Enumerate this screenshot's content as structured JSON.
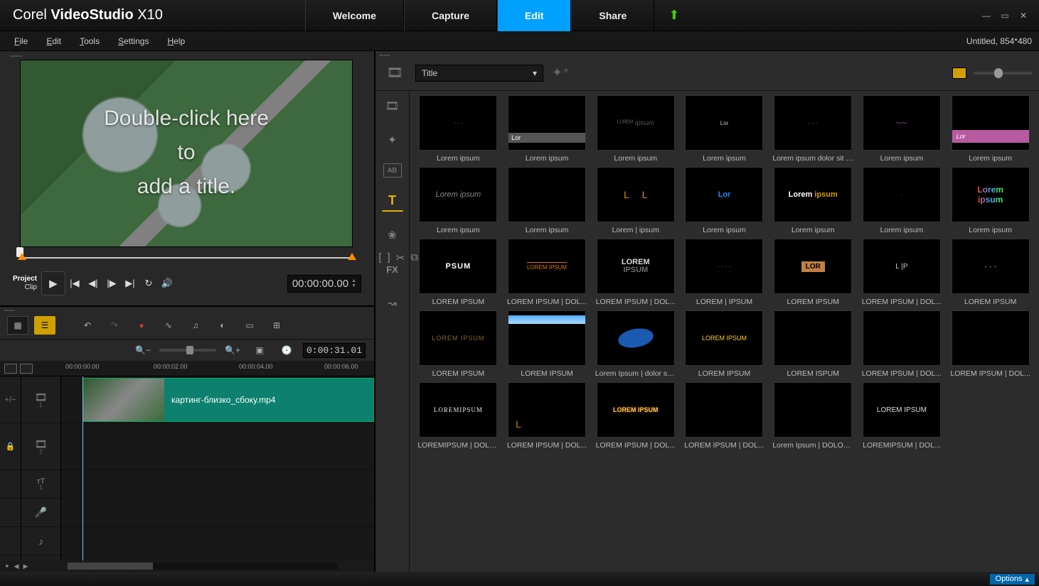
{
  "app": {
    "brand": "Corel",
    "name1": "VideoStudio",
    "name2": "X10"
  },
  "doc_info": "Untitled, 854*480",
  "main_tabs": {
    "welcome": "Welcome",
    "capture": "Capture",
    "edit": "Edit",
    "share": "Share"
  },
  "menu": {
    "file": "File",
    "edit": "Edit",
    "tools": "Tools",
    "settings": "Settings",
    "help": "Help"
  },
  "preview": {
    "title_line1": "Double-click here",
    "title_line2": "to",
    "title_line3": "add a title.",
    "mode_project": "Project",
    "mode_clip": "Clip",
    "timecode": "00:00:00.00"
  },
  "timeline": {
    "duration": "0:00:31.01",
    "ticks": [
      "00:00:00.00",
      "00:00:02.00",
      "00:00:04.00",
      "00:00:06.00"
    ],
    "toggle_label": "+/−",
    "clip_name": "картинг-близко_сбоку.mp4",
    "track_numbers": [
      "1",
      "2",
      "1"
    ]
  },
  "library": {
    "category_selected": "Title",
    "cats": [
      "media",
      "transition",
      "ab",
      "title",
      "graphic",
      "fx",
      "path"
    ],
    "items": [
      {
        "label": "Lorem ipsum",
        "style": "dots"
      },
      {
        "label": "Lorem ipsum",
        "style": "lor-banner",
        "text": "Lor"
      },
      {
        "label": "Lorem ipsum",
        "style": "faint",
        "text": "ᴸᴼᴿᴱᴹ ipsum"
      },
      {
        "label": "Lorem ipsum",
        "style": "small",
        "text": "Lor"
      },
      {
        "label": "Lorem ipsum dolor sit a...",
        "style": "tiny",
        "text": "· · ·"
      },
      {
        "label": "Lorem ipsum",
        "style": "squiggle"
      },
      {
        "label": "Lorem ipsum",
        "style": "pink",
        "text": "Lor"
      },
      {
        "label": "Lorem ipsum",
        "style": "italic",
        "text": "Lorem ipsum"
      },
      {
        "label": "Lorem ipsum",
        "style": "blank"
      },
      {
        "label": "Lorem | ipsum",
        "style": "orange-l",
        "text": "L"
      },
      {
        "label": "Lorem ipsum",
        "style": "blue",
        "text": "Lor"
      },
      {
        "label": "Lorem ipsum",
        "style": "twotone",
        "text": "Lorem ipsum"
      },
      {
        "label": "Lorem ipsum",
        "style": "tiny2",
        "text": "·"
      },
      {
        "label": "Lorem ipsum",
        "style": "grad",
        "text": "Lorem ipsum"
      },
      {
        "label": "LOREM IPSUM",
        "style": "psum",
        "text": "PSUM"
      },
      {
        "label": "LOREM IPSUM | DOL...",
        "style": "orange-line",
        "text": "LOREM IPSUM"
      },
      {
        "label": "LOREM IPSUM | DOL...",
        "style": "stack",
        "text": "LOREM\nIPSUM"
      },
      {
        "label": "LOREM | IPSUM",
        "style": "split",
        "text": "· ·   · ·"
      },
      {
        "label": "LOREM IPSUM",
        "style": "orange-box",
        "text": "LOR"
      },
      {
        "label": "LOREM IPSUM | DOL...",
        "style": "side",
        "text": "L   |P"
      },
      {
        "label": "LOREM IPSUM",
        "style": "diag-dots"
      },
      {
        "label": "LOREM IPSUM",
        "style": "red-caps",
        "text": "LOREM IPSUM"
      },
      {
        "label": "LOREM IPSUM",
        "style": "sky"
      },
      {
        "label": "Lorem Ipsum |  dolor sit ...",
        "style": "oval"
      },
      {
        "label": "LOREM IPSUM",
        "style": "yellow",
        "text": "LOREM IPSUM"
      },
      {
        "label": "LOREM ISPUM",
        "style": "blank"
      },
      {
        "label": "LOREM IPSUM | DOL...",
        "style": "blank"
      },
      {
        "label": "LOREM IPSUM | DOL...",
        "style": "blank"
      },
      {
        "label": "LOREMIPSUM | DOLO...",
        "style": "serif",
        "text": "LOREMIPSUM"
      },
      {
        "label": "LOREM IPSUM | DOL...",
        "style": "corner",
        "text": "L"
      },
      {
        "label": "LOREM IPSUM | DOL...",
        "style": "gold",
        "text": "LOREM IPSUM"
      },
      {
        "label": "LOREM IPSUM | DOL...",
        "style": "blank"
      },
      {
        "label": "Lorem Ipsum | DOLOR ...",
        "style": "blank"
      },
      {
        "label": "LOREMIPSUM | DOL...",
        "style": "plain",
        "text": "LOREM IPSUM"
      }
    ]
  },
  "status": {
    "options": "Options"
  }
}
